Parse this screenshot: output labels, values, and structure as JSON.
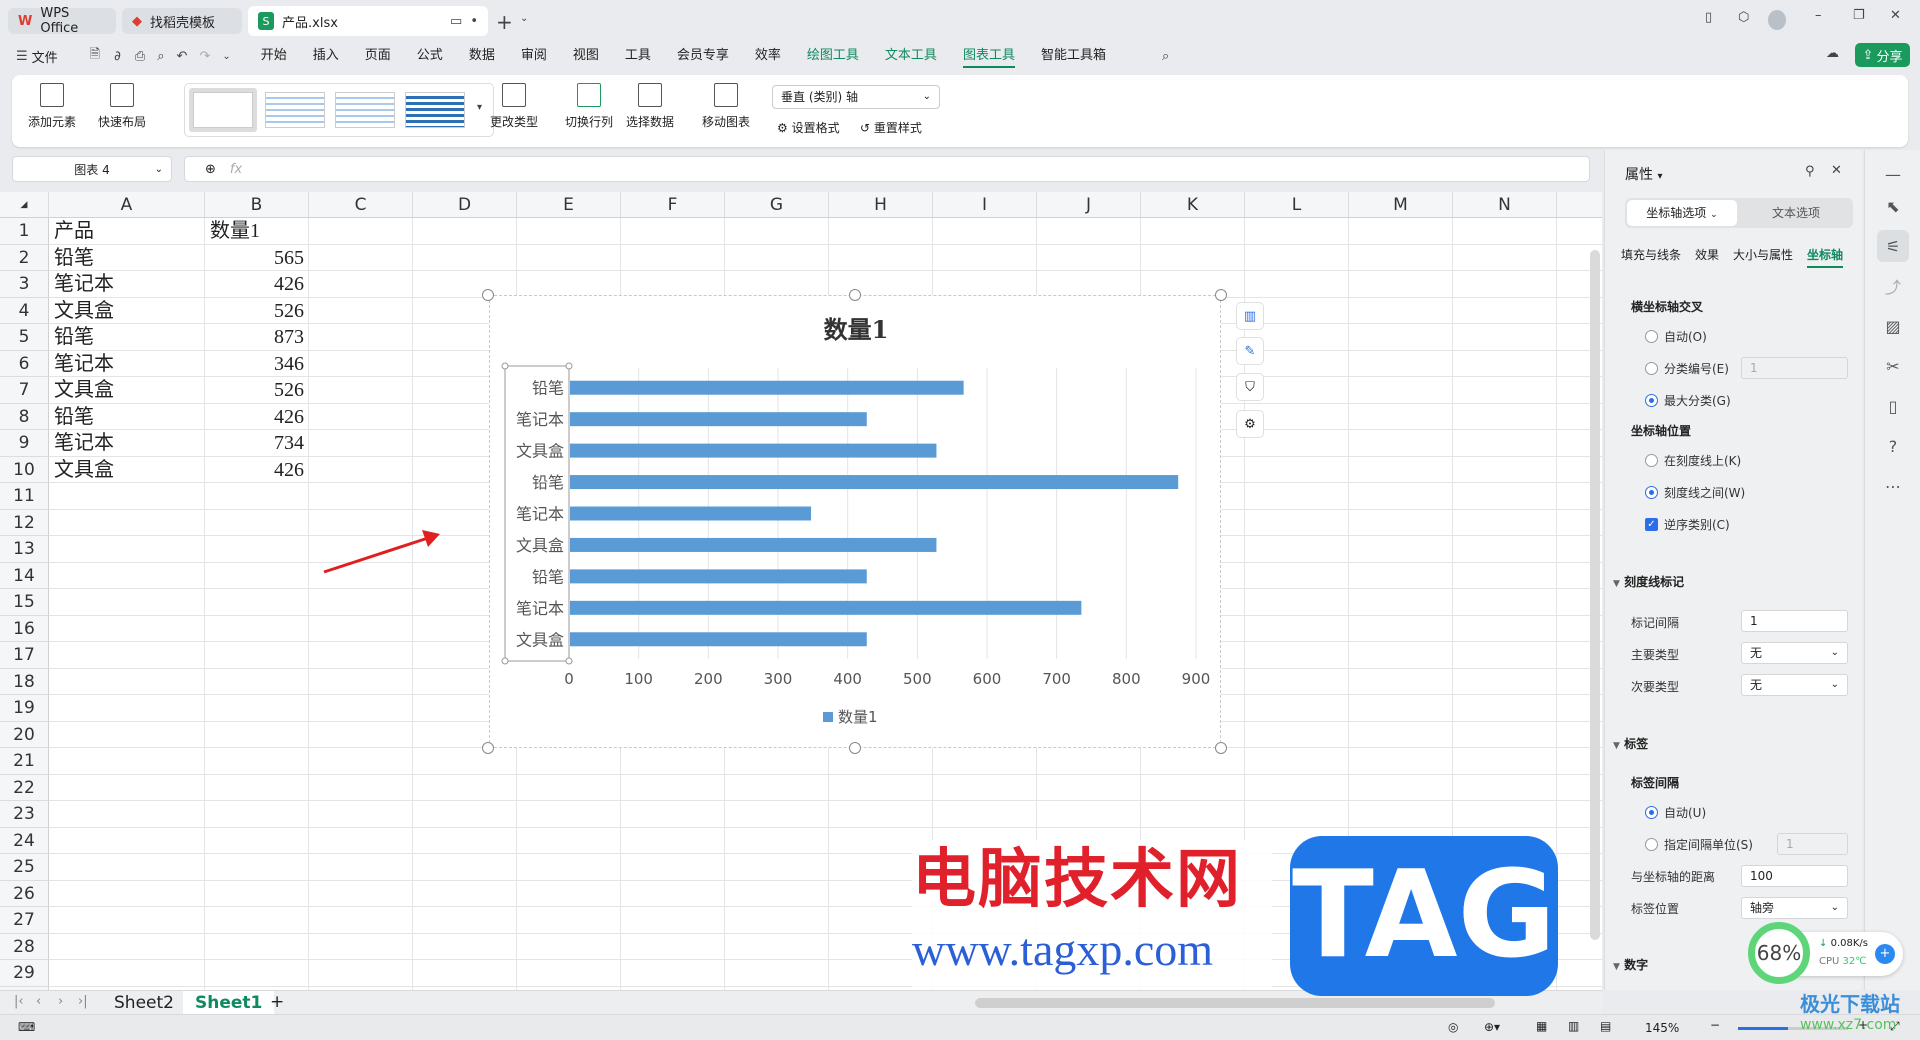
{
  "window": {
    "tabs": [
      {
        "label": "WPS Office",
        "icon": "wps-logo-icon"
      },
      {
        "label": "找稻壳模板",
        "icon": "docer-icon"
      },
      {
        "label": "产品.xlsx",
        "icon": "spreadsheet-icon"
      }
    ]
  },
  "menu": {
    "file": "文件",
    "items": [
      "开始",
      "插入",
      "页面",
      "公式",
      "数据",
      "审阅",
      "视图",
      "工具",
      "会员专享",
      "效率",
      "绘图工具",
      "文本工具",
      "图表工具",
      "智能工具箱"
    ],
    "active": "图表工具",
    "share": "分享"
  },
  "ribbon": {
    "add_element": "添加元素",
    "quick_layout": "快速布局",
    "change_type": "更改类型",
    "switch_row_col": "切换行列",
    "select_data": "选择数据",
    "move_chart": "移动图表",
    "axis_select": "垂直 (类别) 轴",
    "set_format": "设置格式",
    "reset_style": "重置样式"
  },
  "formula": {
    "name_box": "图表 4",
    "fx": "fx",
    "value": ""
  },
  "grid": {
    "columns": [
      "A",
      "B",
      "C",
      "D",
      "E",
      "F",
      "G",
      "H",
      "I",
      "J",
      "K",
      "L",
      "M",
      "N"
    ],
    "row_count": 30
  },
  "cells": [
    [
      "产品",
      "数量1"
    ],
    [
      "铅笔",
      "565"
    ],
    [
      "笔记本",
      "426"
    ],
    [
      "文具盒",
      "526"
    ],
    [
      "铅笔",
      "873"
    ],
    [
      "笔记本",
      "346"
    ],
    [
      "文具盒",
      "526"
    ],
    [
      "铅笔",
      "426"
    ],
    [
      "笔记本",
      "734"
    ],
    [
      "文具盒",
      "426"
    ]
  ],
  "chart_data": {
    "type": "bar",
    "orientation": "horizontal",
    "title": "数量1",
    "categories": [
      "铅笔",
      "笔记本",
      "文具盒",
      "铅笔",
      "笔记本",
      "文具盒",
      "铅笔",
      "笔记本",
      "文具盒"
    ],
    "series": [
      {
        "name": "数量1",
        "values": [
          565,
          426,
          526,
          873,
          346,
          526,
          426,
          734,
          426
        ],
        "color": "#5b9bd5"
      }
    ],
    "xlim": [
      0,
      900
    ],
    "xticks": [
      0,
      100,
      200,
      300,
      400,
      500,
      600,
      700,
      800,
      900
    ],
    "grid": true,
    "legend": "bottom",
    "reverse_categories": true
  },
  "chart_tools": [
    "chart-elements-icon",
    "chart-style-icon",
    "chart-filter-icon",
    "chart-settings-icon"
  ],
  "panel": {
    "title": "属性",
    "tab_axis": "坐标轴选项",
    "tab_text": "文本选项",
    "subtabs": [
      "填充与线条",
      "效果",
      "大小与属性",
      "坐标轴"
    ],
    "cross_title": "横坐标轴交叉",
    "cross_auto": "自动(O)",
    "cross_cat": "分类编号(E)",
    "cross_cat_value": "1",
    "cross_max": "最大分类(G)",
    "pos_title": "坐标轴位置",
    "pos_on": "在刻度线上(K)",
    "pos_between": "刻度线之间(W)",
    "reverse": "逆序类别(C)",
    "tick_title": "刻度线标记",
    "tick_interval": "标记间隔",
    "tick_interval_value": "1",
    "major": "主要类型",
    "major_value": "无",
    "minor": "次要类型",
    "minor_value": "无",
    "label_title": "标签",
    "label_interval": "标签间隔",
    "label_auto": "自动(U)",
    "label_unit": "指定间隔单位(S)",
    "label_unit_value": "1",
    "label_dist": "与坐标轴的距离",
    "label_dist_value": "100",
    "label_pos": "标签位置",
    "label_pos_value": "轴旁",
    "number_title": "数字"
  },
  "sheets": {
    "tabs": [
      "Sheet2",
      "Sheet1"
    ],
    "active": "Sheet1"
  },
  "status": {
    "zoom": "145%",
    "zoom_fraction": 0.45
  },
  "overlays": {
    "watermark_cn": "电脑技术网",
    "watermark_url": "www.tagxp.com",
    "watermark_logo": "TAG",
    "widget_percent": "68%",
    "widget_net": "0.08K/s",
    "widget_cpu": "CPU",
    "widget_temp": "32℃",
    "site_logo": "极光下载站",
    "site_url": "www.xz7.com"
  },
  "colors": {
    "accent": "#0f8a5f",
    "bar": "#5b9bd5",
    "arrow": "#e02020"
  }
}
